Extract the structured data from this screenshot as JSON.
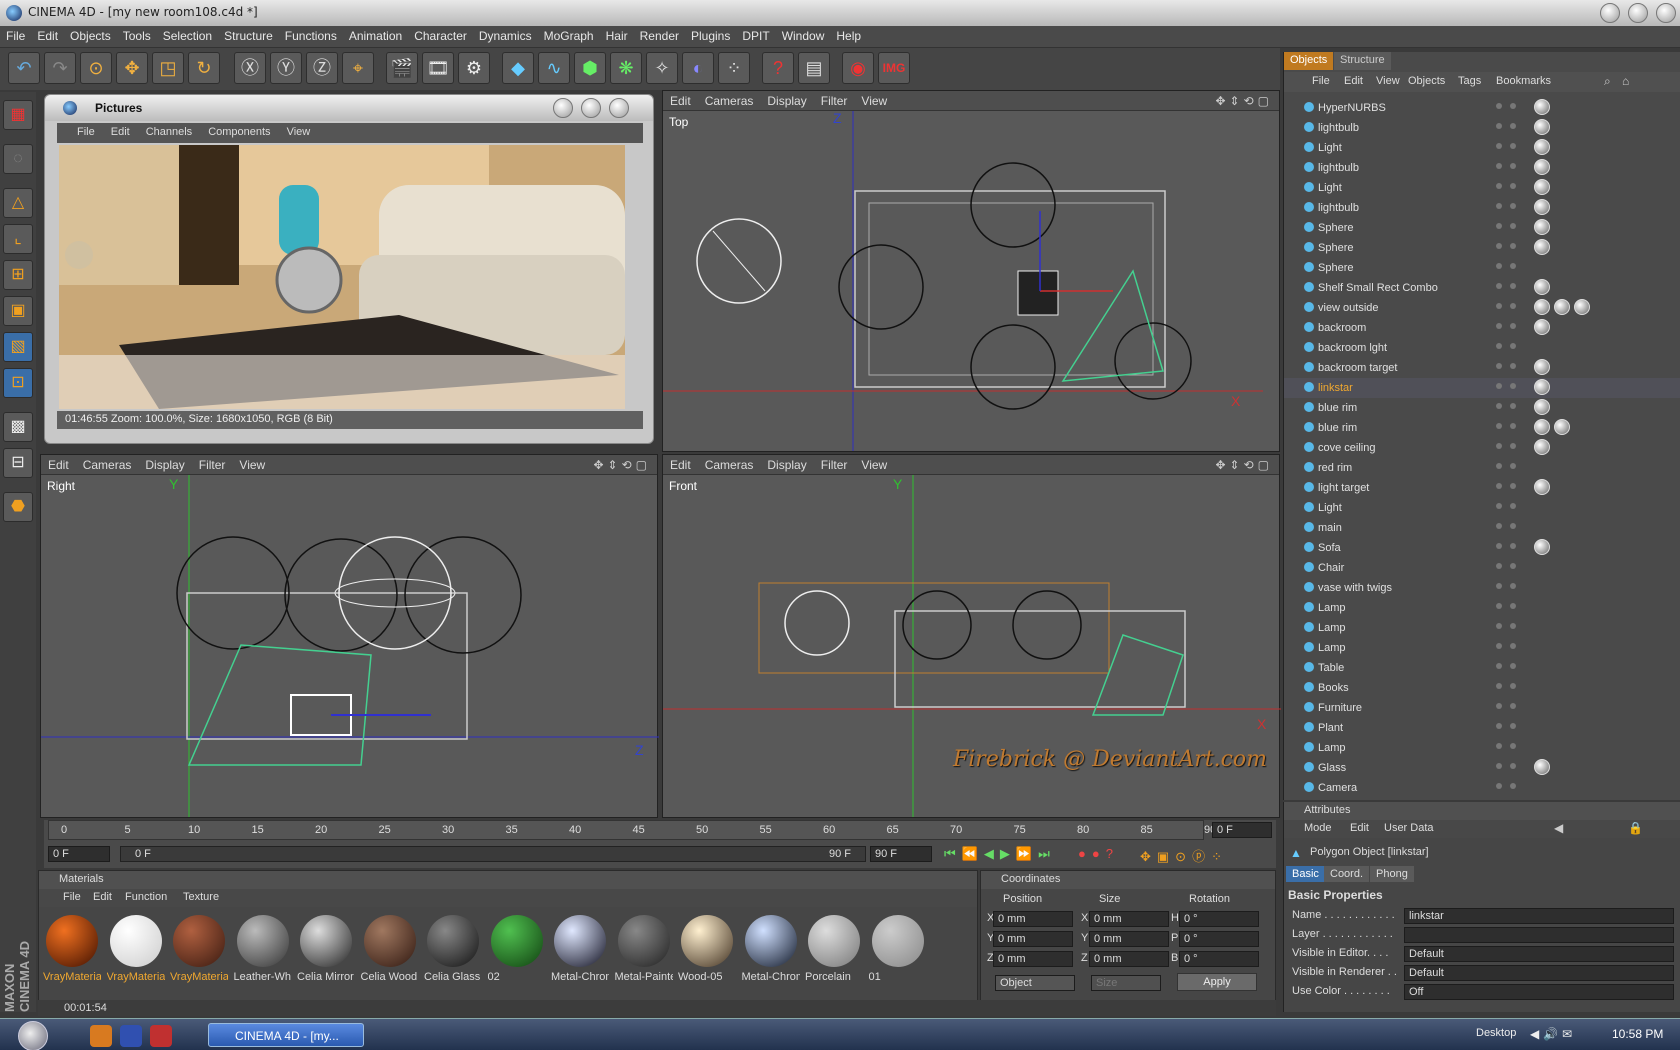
{
  "app": {
    "title": "CINEMA 4D - [my new room108.c4d *]"
  },
  "menu": [
    "File",
    "Edit",
    "Objects",
    "Tools",
    "Selection",
    "Structure",
    "Functions",
    "Animation",
    "Character",
    "Dynamics",
    "MoGraph",
    "Hair",
    "Render",
    "Plugins",
    "DPIT",
    "Window",
    "Help"
  ],
  "toolbar": {
    "img_label": "IMG"
  },
  "pictures": {
    "title": "Pictures",
    "menu": [
      "File",
      "Edit",
      "Channels",
      "Components",
      "View"
    ],
    "status": "01:46:55 Zoom: 100.0%, Size: 1680x1050, RGB (8 Bit)"
  },
  "viewports": {
    "menu": [
      "Edit",
      "Cameras",
      "Display",
      "Filter",
      "View"
    ],
    "top": {
      "label": "Top",
      "axis_z": "Z",
      "axis_x": "X"
    },
    "right": {
      "label": "Right",
      "axis_y": "Y",
      "axis_z": "Z"
    },
    "front": {
      "label": "Front",
      "axis_y": "Y",
      "axis_x": "X"
    },
    "watermark": "Firebrick @ DeviantArt.com"
  },
  "objects": {
    "tabs": [
      "Objects",
      "Structure"
    ],
    "menu": [
      "File",
      "Edit",
      "View",
      "Objects",
      "Tags",
      "Bookmarks"
    ],
    "items": [
      {
        "name": "HyperNURBS",
        "color": "#e0e0e0"
      },
      {
        "name": "lightbulb",
        "color": "#e0e0e0"
      },
      {
        "name": "Light",
        "color": "#e0e0e0"
      },
      {
        "name": "lightbulb",
        "color": "#e0e0e0"
      },
      {
        "name": "Light",
        "color": "#e0e0e0"
      },
      {
        "name": "lightbulb",
        "color": "#e0e0e0"
      },
      {
        "name": "Sphere",
        "color": "#e0e0e0"
      },
      {
        "name": "Sphere",
        "color": "#e0e0e0"
      },
      {
        "name": "Sphere",
        "color": "#e0e0e0"
      },
      {
        "name": "Shelf Small Rect Combo",
        "color": "#e0e0e0"
      },
      {
        "name": "view outside",
        "color": "#e0e0e0"
      },
      {
        "name": "backroom",
        "color": "#e0e0e0"
      },
      {
        "name": "backroom lght",
        "color": "#e0e0e0"
      },
      {
        "name": "backroom target",
        "color": "#e0e0e0"
      },
      {
        "name": "linkstar",
        "color": "#f0a830"
      },
      {
        "name": "blue rim",
        "color": "#e0e0e0"
      },
      {
        "name": "blue rim",
        "color": "#e0e0e0"
      },
      {
        "name": "cove ceiling",
        "color": "#e0e0e0"
      },
      {
        "name": "red rim",
        "color": "#e0e0e0"
      },
      {
        "name": "light target",
        "color": "#e0e0e0"
      },
      {
        "name": "Light",
        "color": "#e0e0e0"
      },
      {
        "name": "main",
        "color": "#e0e0e0"
      },
      {
        "name": "Sofa",
        "color": "#e0e0e0"
      },
      {
        "name": "Chair",
        "color": "#e0e0e0"
      },
      {
        "name": "vase with twigs",
        "color": "#e0e0e0"
      },
      {
        "name": "Lamp",
        "color": "#e0e0e0"
      },
      {
        "name": "Lamp",
        "color": "#e0e0e0"
      },
      {
        "name": "Lamp",
        "color": "#e0e0e0"
      },
      {
        "name": "Table",
        "color": "#e0e0e0"
      },
      {
        "name": "Books",
        "color": "#e0e0e0"
      },
      {
        "name": "Furniture",
        "color": "#e0e0e0"
      },
      {
        "name": "Plant",
        "color": "#e0e0e0"
      },
      {
        "name": "Lamp",
        "color": "#e0e0e0"
      },
      {
        "name": "Glass",
        "color": "#e0e0e0"
      },
      {
        "name": "Camera",
        "color": "#e0e0e0"
      }
    ]
  },
  "timeline": {
    "ticks": [
      "0",
      "5",
      "10",
      "15",
      "20",
      "25",
      "30",
      "35",
      "40",
      "45",
      "50",
      "55",
      "60",
      "65",
      "70",
      "75",
      "80",
      "85",
      "90"
    ],
    "current": "0 F",
    "start": "0 F",
    "range_start": "0 F",
    "range_end": "90 F",
    "end": "90 F"
  },
  "materials": {
    "title": "Materials",
    "menu": [
      "File",
      "Edit",
      "Function",
      "Texture"
    ],
    "items": [
      {
        "label": "VrayMateria",
        "c1": "#f07020",
        "c2": "#401000"
      },
      {
        "label": "VrayMateria",
        "c1": "#ffffff",
        "c2": "#cccccc"
      },
      {
        "label": "VrayMateria",
        "c1": "#b06040",
        "c2": "#3a1a10"
      },
      {
        "label": "Leather-Wh",
        "c1": "#bbbbbb",
        "c2": "#333333"
      },
      {
        "label": "Celia Mirror",
        "c1": "#dddddd",
        "c2": "#222222"
      },
      {
        "label": "Celia Wood",
        "c1": "#a07860",
        "c2": "#301810"
      },
      {
        "label": "Celia Glass",
        "c1": "#888888",
        "c2": "#111111"
      },
      {
        "label": "02",
        "c1": "#50c050",
        "c2": "#104010"
      },
      {
        "label": "Metal-Chrom",
        "c1": "#e0e8ff",
        "c2": "#101020"
      },
      {
        "label": "Metal-Painte",
        "c1": "#888888",
        "c2": "#202020"
      },
      {
        "label": "Wood-05",
        "c1": "#fff0d0",
        "c2": "#403020"
      },
      {
        "label": "Metal-Chrom",
        "c1": "#d0e0ff",
        "c2": "#101828"
      },
      {
        "label": "Porcelain",
        "c1": "#dddddd",
        "c2": "#777777"
      },
      {
        "label": "01",
        "c1": "#cccccc",
        "c2": "#888888"
      }
    ]
  },
  "coordinates": {
    "title": "Coordinates",
    "headers": [
      "Position",
      "Size",
      "Rotation"
    ],
    "rows": [
      {
        "a": "X",
        "av": "0 mm",
        "b": "X",
        "bv": "0 mm",
        "c": "H",
        "cv": "0 °"
      },
      {
        "a": "Y",
        "av": "0 mm",
        "b": "Y",
        "bv": "0 mm",
        "c": "P",
        "cv": "0 °"
      },
      {
        "a": "Z",
        "av": "0 mm",
        "b": "Z",
        "bv": "0 mm",
        "c": "B",
        "cv": "0 °"
      }
    ],
    "mode": "Object",
    "size_mode": "Size",
    "apply": "Apply"
  },
  "attributes": {
    "title": "Attributes",
    "menu": [
      "Mode",
      "Edit",
      "User Data"
    ],
    "object": "Polygon Object [linkstar]",
    "tabs": [
      "Basic",
      "Coord.",
      "Phong"
    ],
    "section": "Basic Properties",
    "fields": [
      {
        "label": "Name . . . . . . . . . . . .",
        "value": "linkstar"
      },
      {
        "label": "Layer . . . . . . . . . . . .",
        "value": ""
      },
      {
        "label": "Visible in Editor. . . .",
        "value": "Default"
      },
      {
        "label": "Visible in Renderer . .",
        "value": "Default"
      },
      {
        "label": "Use Color . . . . . . . .",
        "value": "Off"
      }
    ]
  },
  "status": {
    "time": "00:01:54"
  },
  "taskbar": {
    "task": "CINEMA 4D - [my...",
    "desktop": "Desktop",
    "clock": "10:58 PM"
  },
  "brand": "MAXON CINEMA 4D"
}
